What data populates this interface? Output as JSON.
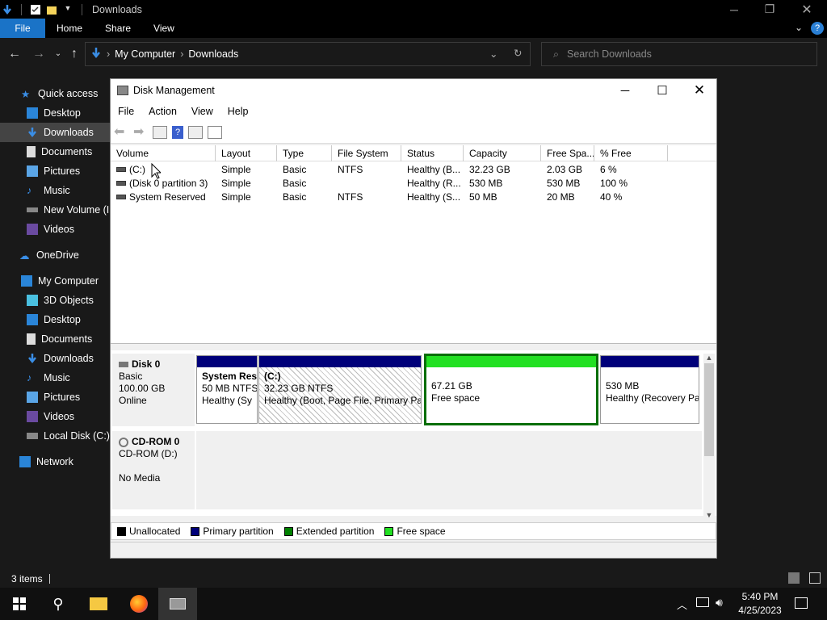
{
  "explorer": {
    "title": "Downloads",
    "tabs": [
      "File",
      "Home",
      "Share",
      "View"
    ],
    "breadcrumb": [
      "My Computer",
      "Downloads"
    ],
    "search_placeholder": "Search Downloads",
    "nav": {
      "quick_access": "Quick access",
      "quick_items": [
        "Desktop",
        "Downloads",
        "Documents",
        "Pictures",
        "Music",
        "New Volume (I:)",
        "Videos"
      ],
      "onedrive": "OneDrive",
      "my_computer": "My Computer",
      "pc_items": [
        "3D Objects",
        "Desktop",
        "Documents",
        "Downloads",
        "Music",
        "Pictures",
        "Videos",
        "Local Disk (C:)"
      ],
      "network": "Network"
    },
    "status": "3 items"
  },
  "disk_management": {
    "title": "Disk Management",
    "menu": [
      "File",
      "Action",
      "View",
      "Help"
    ],
    "columns": [
      "Volume",
      "Layout",
      "Type",
      "File System",
      "Status",
      "Capacity",
      "Free Spa...",
      "% Free"
    ],
    "rows": [
      {
        "volume": "(C:)",
        "layout": "Simple",
        "type": "Basic",
        "fs": "NTFS",
        "status": "Healthy (B...",
        "capacity": "32.23 GB",
        "free": "2.03 GB",
        "pct": "6 %"
      },
      {
        "volume": "(Disk 0 partition 3)",
        "layout": "Simple",
        "type": "Basic",
        "fs": "",
        "status": "Healthy (R...",
        "capacity": "530 MB",
        "free": "530 MB",
        "pct": "100 %"
      },
      {
        "volume": "System Reserved",
        "layout": "Simple",
        "type": "Basic",
        "fs": "NTFS",
        "status": "Healthy (S...",
        "capacity": "50 MB",
        "free": "20 MB",
        "pct": "40 %"
      }
    ],
    "disk0": {
      "name": "Disk 0",
      "type": "Basic",
      "size": "100.00 GB",
      "state": "Online",
      "partitions": [
        {
          "name": "System Res",
          "size": "50 MB NTFS",
          "status": "Healthy (Sy"
        },
        {
          "name": "(C:)",
          "size": "32.23 GB NTFS",
          "status": "Healthy (Boot, Page File, Primary Pa"
        },
        {
          "name": "",
          "size": "67.21 GB",
          "status": "Free space"
        },
        {
          "name": "",
          "size": "530 MB",
          "status": "Healthy (Recovery Pa"
        }
      ]
    },
    "cdrom": {
      "name": "CD-ROM 0",
      "drive": "CD-ROM (D:)",
      "media": "No Media"
    },
    "legend": [
      "Unallocated",
      "Primary partition",
      "Extended partition",
      "Free space"
    ],
    "legend_colors": [
      "#000000",
      "#00007a",
      "#008000",
      "#22e022"
    ]
  },
  "taskbar": {
    "time": "5:40 PM",
    "date": "4/25/2023"
  }
}
